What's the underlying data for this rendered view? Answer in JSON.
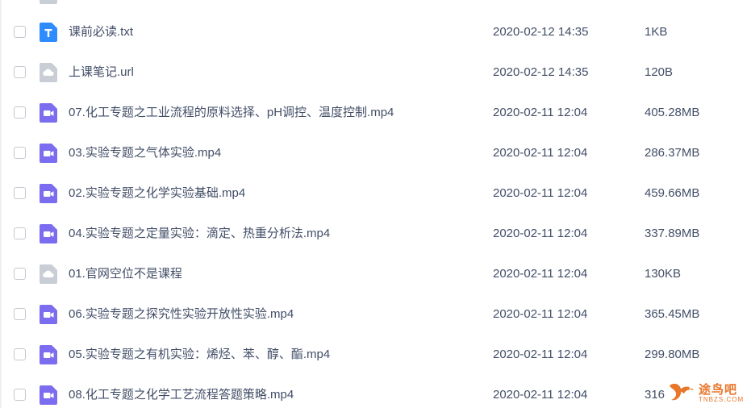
{
  "files": [
    {
      "name": "课前必读.txt",
      "date": "2020-02-12 14:35",
      "size": "1KB",
      "icon": "txt-file-icon"
    },
    {
      "name": "上课笔记.url",
      "date": "2020-02-12 14:35",
      "size": "120B",
      "icon": "link-file-icon"
    },
    {
      "name": "07.化工专题之工业流程的原料选择、pH调控、温度控制.mp4",
      "date": "2020-02-11 12:04",
      "size": "405.28MB",
      "icon": "video-file-icon"
    },
    {
      "name": "03.实验专题之气体实验.mp4",
      "date": "2020-02-11 12:04",
      "size": "286.37MB",
      "icon": "video-file-icon"
    },
    {
      "name": "02.实验专题之化学实验基础.mp4",
      "date": "2020-02-11 12:04",
      "size": "459.66MB",
      "icon": "video-file-icon"
    },
    {
      "name": "04.实验专题之定量实验：滴定、热重分析法.mp4",
      "date": "2020-02-11 12:04",
      "size": "337.89MB",
      "icon": "video-file-icon"
    },
    {
      "name": "01.官网空位不是课程",
      "date": "2020-02-11 12:04",
      "size": "130KB",
      "icon": "link-file-icon"
    },
    {
      "name": "06.实验专题之探究性实验开放性实验.mp4",
      "date": "2020-02-11 12:04",
      "size": "365.45MB",
      "icon": "video-file-icon"
    },
    {
      "name": "05.实验专题之有机实验：烯烃、苯、醇、酯.mp4",
      "date": "2020-02-11 12:04",
      "size": "299.80MB",
      "icon": "video-file-icon"
    },
    {
      "name": "08.化工专题之化学工艺流程答题策略.mp4",
      "date": "2020-02-11 12:04",
      "size": "316",
      "icon": "video-file-icon"
    }
  ],
  "watermark": {
    "text": "途鸟吧",
    "sub": "TNBZS.COM"
  },
  "colors": {
    "txt_icon": "#2f8cff",
    "link_icon": "#c8cdd6",
    "video_icon": "#7b6cf0",
    "text": "#424e67",
    "watermark": "#e8762b"
  }
}
